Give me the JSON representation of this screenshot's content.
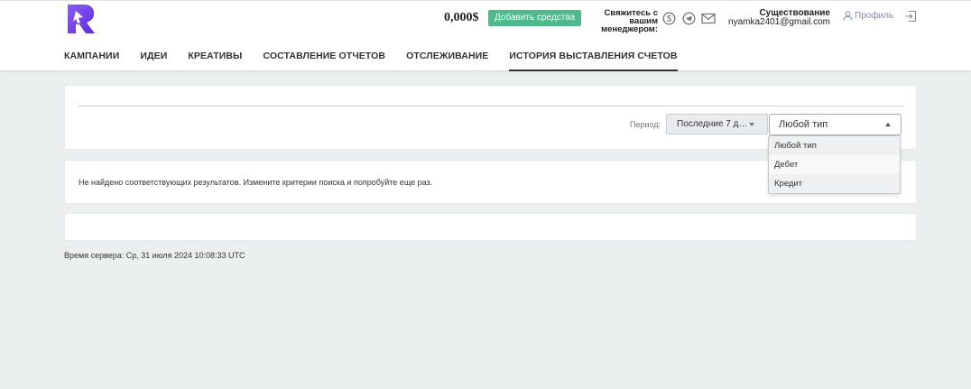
{
  "header": {
    "balance": "0,000$",
    "add_funds_label": "Добавить средства",
    "contact_label_line1": "Свяжитесь с",
    "contact_label_line2": "вашим",
    "contact_label_line3": "менеджером:",
    "contact_icons": [
      "skype-icon",
      "telegram-icon",
      "mail-icon"
    ],
    "user_status": "Существование",
    "user_email": "nyamka2401@gmail.com",
    "profile_label": "Профиль"
  },
  "nav": {
    "items": [
      {
        "label": "КАМПАНИИ",
        "active": false
      },
      {
        "label": "ИДЕИ",
        "active": false
      },
      {
        "label": "КРЕАТИВЫ",
        "active": false
      },
      {
        "label": "СОСТАВЛЕНИЕ ОТЧЕТОВ",
        "active": false
      },
      {
        "label": "ОТСЛЕЖИВАНИЕ",
        "active": false
      },
      {
        "label": "ИСТОРИЯ ВЫСТАВЛЕНИЯ СЧЕТОВ",
        "active": true
      }
    ]
  },
  "filters": {
    "period_label": "Период:",
    "period_value": "Последние 7 д…",
    "type_value": "Любой тип",
    "type_options": [
      "Любой тип",
      "Дебет",
      "Кредит"
    ]
  },
  "results": {
    "empty_message": "Не найдено соответствующих результатов. Измените критерии поиска и попробуйте еще раз."
  },
  "footer": {
    "server_time": "Время сервера: Ср, 31 июля 2024 10:08:33 UTC"
  },
  "colors": {
    "accent_green": "#4cba8b",
    "logo_purple": "#6a3ff2",
    "profile_link": "#7c89b6",
    "background": "#ecefef"
  }
}
